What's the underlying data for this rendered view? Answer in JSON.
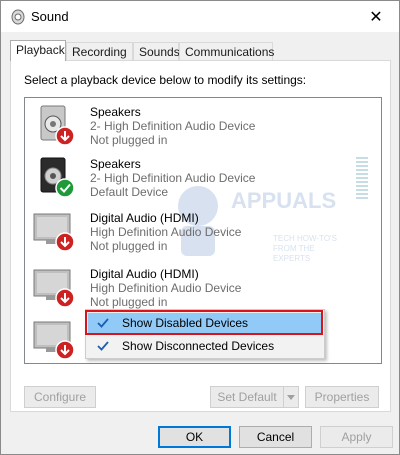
{
  "window": {
    "title": "Sound",
    "close_glyph": "✕"
  },
  "tabs": [
    {
      "label": "Playback",
      "active": true
    },
    {
      "label": "Recording",
      "active": false
    },
    {
      "label": "Sounds",
      "active": false
    },
    {
      "label": "Communications",
      "active": false
    }
  ],
  "instruction": "Select a playback device below to modify its settings:",
  "devices": [
    {
      "name": "Speakers",
      "description": "2- High Definition Audio Device",
      "status": "Not plugged in",
      "icon": "speaker-icon",
      "badge": "unplugged-arrow-icon"
    },
    {
      "name": "Speakers",
      "description": "2- High Definition Audio Device",
      "status": "Default Device",
      "icon": "speaker-icon",
      "badge": "default-check-icon"
    },
    {
      "name": "Digital Audio (HDMI)",
      "description": "High Definition Audio Device",
      "status": "Not plugged in",
      "icon": "monitor-icon",
      "badge": "unplugged-arrow-icon"
    },
    {
      "name": "Digital Audio (HDMI)",
      "description": "High Definition Audio Device",
      "status": "Not plugged in",
      "icon": "monitor-icon",
      "badge": "unplugged-arrow-icon"
    },
    {
      "name": "",
      "description": "",
      "status": "",
      "icon": "monitor-icon",
      "badge": "unplugged-arrow-icon"
    }
  ],
  "watermark": {
    "brand": "APPUALS",
    "tagline": "TECH HOW-TO'S FROM THE EXPERTS"
  },
  "context_menu": {
    "items": [
      {
        "label": "Show Disabled Devices",
        "checked": true,
        "highlighted": true
      },
      {
        "label": "Show Disconnected Devices",
        "checked": true,
        "highlighted": false
      }
    ]
  },
  "buttons": {
    "configure": "Configure",
    "set_default": "Set Default",
    "properties": "Properties",
    "ok": "OK",
    "cancel": "Cancel",
    "apply": "Apply"
  },
  "colors": {
    "highlight": "#91c9f7",
    "annotation_border": "#d9141a",
    "default_badge": "#1e9a3a",
    "unplugged_badge": "#cc2222",
    "check_color": "#1a5fb4"
  }
}
